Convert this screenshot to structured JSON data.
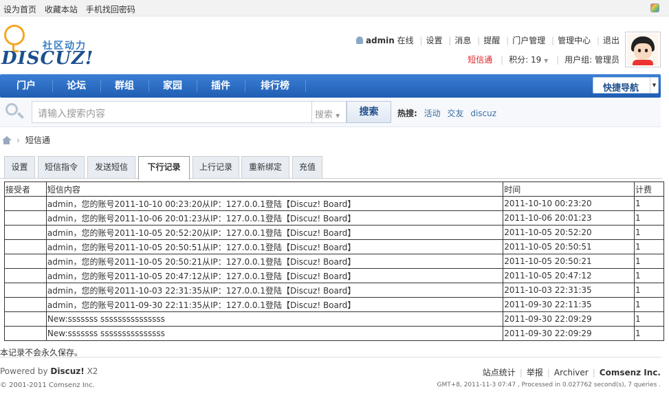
{
  "topbar": {
    "links": [
      "设为首页",
      "收藏本站",
      "手机找回密码"
    ],
    "skin_icon": "color-palette-icon"
  },
  "logo": {
    "cn": "社区动力",
    "en": "DISCUZ!",
    "bulb_color": "#f5a623"
  },
  "user": {
    "name": "admin",
    "status": "在线",
    "menu": [
      "设置",
      "消息",
      "提醒",
      "门户管理",
      "管理中心",
      "退出"
    ],
    "sms_link": "短信通",
    "points_label": "积分: 19",
    "group_label": "用户组: 管理员"
  },
  "nav": {
    "items": [
      "门户",
      "论坛",
      "群组",
      "家园",
      "插件",
      "排行榜"
    ],
    "quick_nav": "快捷导航",
    "color": "#2b6cc4"
  },
  "search": {
    "placeholder": "请输入搜索内容",
    "type_label": "搜索",
    "button": "搜索",
    "hot_label": "热搜:",
    "hot_terms": [
      "活动",
      "交友",
      "discuz"
    ]
  },
  "breadcrumb": {
    "current": "短信通"
  },
  "tabs": [
    "设置",
    "短信指令",
    "发送短信",
    "下行记录",
    "上行记录",
    "重新绑定",
    "充值"
  ],
  "active_tab": "下行记录",
  "table": {
    "headers": [
      "接受者",
      "短信内容",
      "时间",
      "计费"
    ],
    "rows": [
      [
        "",
        "admin，您的账号2011-10-10 00:23:20从IP：127.0.0.1登陆【Discuz! Board】",
        "2011-10-10 00:23:20",
        "1"
      ],
      [
        "",
        "admin，您的账号2011-10-06 20:01:23从IP：127.0.0.1登陆【Discuz! Board】",
        "2011-10-06 20:01:23",
        "1"
      ],
      [
        "",
        "admin，您的账号2011-10-05 20:52:20从IP：127.0.0.1登陆【Discuz! Board】",
        "2011-10-05 20:52:20",
        "1"
      ],
      [
        "",
        "admin，您的账号2011-10-05 20:50:51从IP：127.0.0.1登陆【Discuz! Board】",
        "2011-10-05 20:50:51",
        "1"
      ],
      [
        "",
        "admin，您的账号2011-10-05 20:50:21从IP：127.0.0.1登陆【Discuz! Board】",
        "2011-10-05 20:50:21",
        "1"
      ],
      [
        "",
        "admin，您的账号2011-10-05 20:47:12从IP：127.0.0.1登陆【Discuz! Board】",
        "2011-10-05 20:47:12",
        "1"
      ],
      [
        "",
        "admin，您的账号2011-10-03 22:31:35从IP：127.0.0.1登陆【Discuz! Board】",
        "2011-10-03 22:31:35",
        "1"
      ],
      [
        "",
        "admin，您的账号2011-09-30 22:11:35从IP：127.0.0.1登陆【Discuz! Board】",
        "2011-09-30 22:11:35",
        "1"
      ],
      [
        "",
        "New:sssssss sssssssssssssss",
        "2011-09-30 22:09:29",
        "1"
      ],
      [
        "",
        "New:sssssss sssssssssssssss",
        "2011-09-30 22:09:29",
        "1"
      ]
    ]
  },
  "note": "本记录不会永久保存。",
  "footer": {
    "powered_prefix": "Powered by",
    "powered_brand": "Discuz!",
    "powered_version": "X2",
    "copyright": "© 2001-2011 Comsenz Inc.",
    "links": [
      "站点统计",
      "举报",
      "Archiver"
    ],
    "company": "Comsenz Inc.",
    "info": "GMT+8, 2011-11-3 07:47 , Processed in 0.027762 second(s), 7 queries ."
  }
}
